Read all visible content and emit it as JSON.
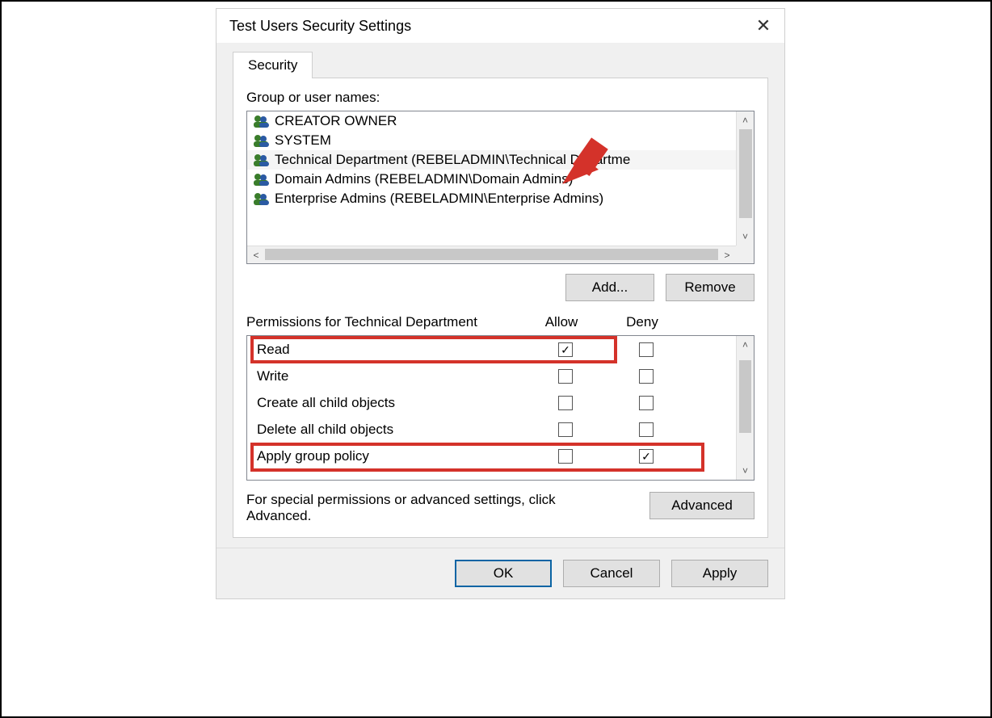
{
  "dialog": {
    "title": "Test Users Security Settings",
    "tab": "Security",
    "groups_label": "Group or user names:",
    "groups": [
      {
        "name": "CREATOR OWNER"
      },
      {
        "name": "SYSTEM"
      },
      {
        "name": "Technical Department (REBELADMIN\\Technical Departme",
        "selected": true
      },
      {
        "name": "Domain Admins (REBELADMIN\\Domain Admins)"
      },
      {
        "name": "Enterprise Admins (REBELADMIN\\Enterprise Admins)"
      }
    ],
    "add_button": "Add...",
    "remove_button": "Remove",
    "permissions_for_label": "Permissions for Technical Department",
    "allow_label": "Allow",
    "deny_label": "Deny",
    "permissions": [
      {
        "name": "Read",
        "allow": true,
        "deny": false
      },
      {
        "name": "Write",
        "allow": false,
        "deny": false
      },
      {
        "name": "Create all child objects",
        "allow": false,
        "deny": false
      },
      {
        "name": "Delete all child objects",
        "allow": false,
        "deny": false
      },
      {
        "name": "Apply group policy",
        "allow": false,
        "deny": true
      }
    ],
    "advanced_text": "For special permissions or advanced settings, click Advanced.",
    "advanced_button": "Advanced",
    "ok_button": "OK",
    "cancel_button": "Cancel",
    "apply_button": "Apply"
  }
}
